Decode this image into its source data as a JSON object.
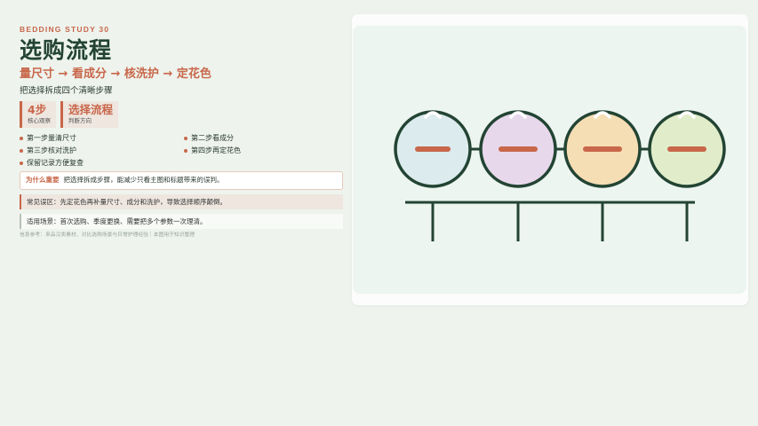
{
  "kicker": "BEDDING STUDY 30",
  "title": "选购流程",
  "subtitle": "量尺寸 → 看成分 → 核洗护 → 定花色",
  "description": "把选择拆成四个清晰步骤",
  "stats": [
    {
      "value": "4步",
      "label": "核心观察"
    },
    {
      "value": "选择流程",
      "label": "判断方向"
    }
  ],
  "steps": [
    "第一步量清尺寸",
    "第二步看成分",
    "第三步核对洗护",
    "第四步再定花色",
    "保留记录方便复查"
  ],
  "why": {
    "label": "为什么重要",
    "text": "把选择拆成步骤，能减少只看主图和标题带来的误判。"
  },
  "mistake": "常见误区：先定花色再补量尺寸、成分和洗护，导致选择顺序颠倒。",
  "fit": "适用场景：首次选购、季度更换、需要把多个参数一次理清。",
  "reference": "信息参考：来品汉卖素材、对比选购场景与日常护理经验｜本图用于知识整理",
  "colors": {
    "accent": "#c8674a",
    "dark_green": "#234433",
    "circle_fills": [
      "#dcebee",
      "#e8d8ec",
      "#f5ddb4",
      "#e1edca"
    ]
  }
}
